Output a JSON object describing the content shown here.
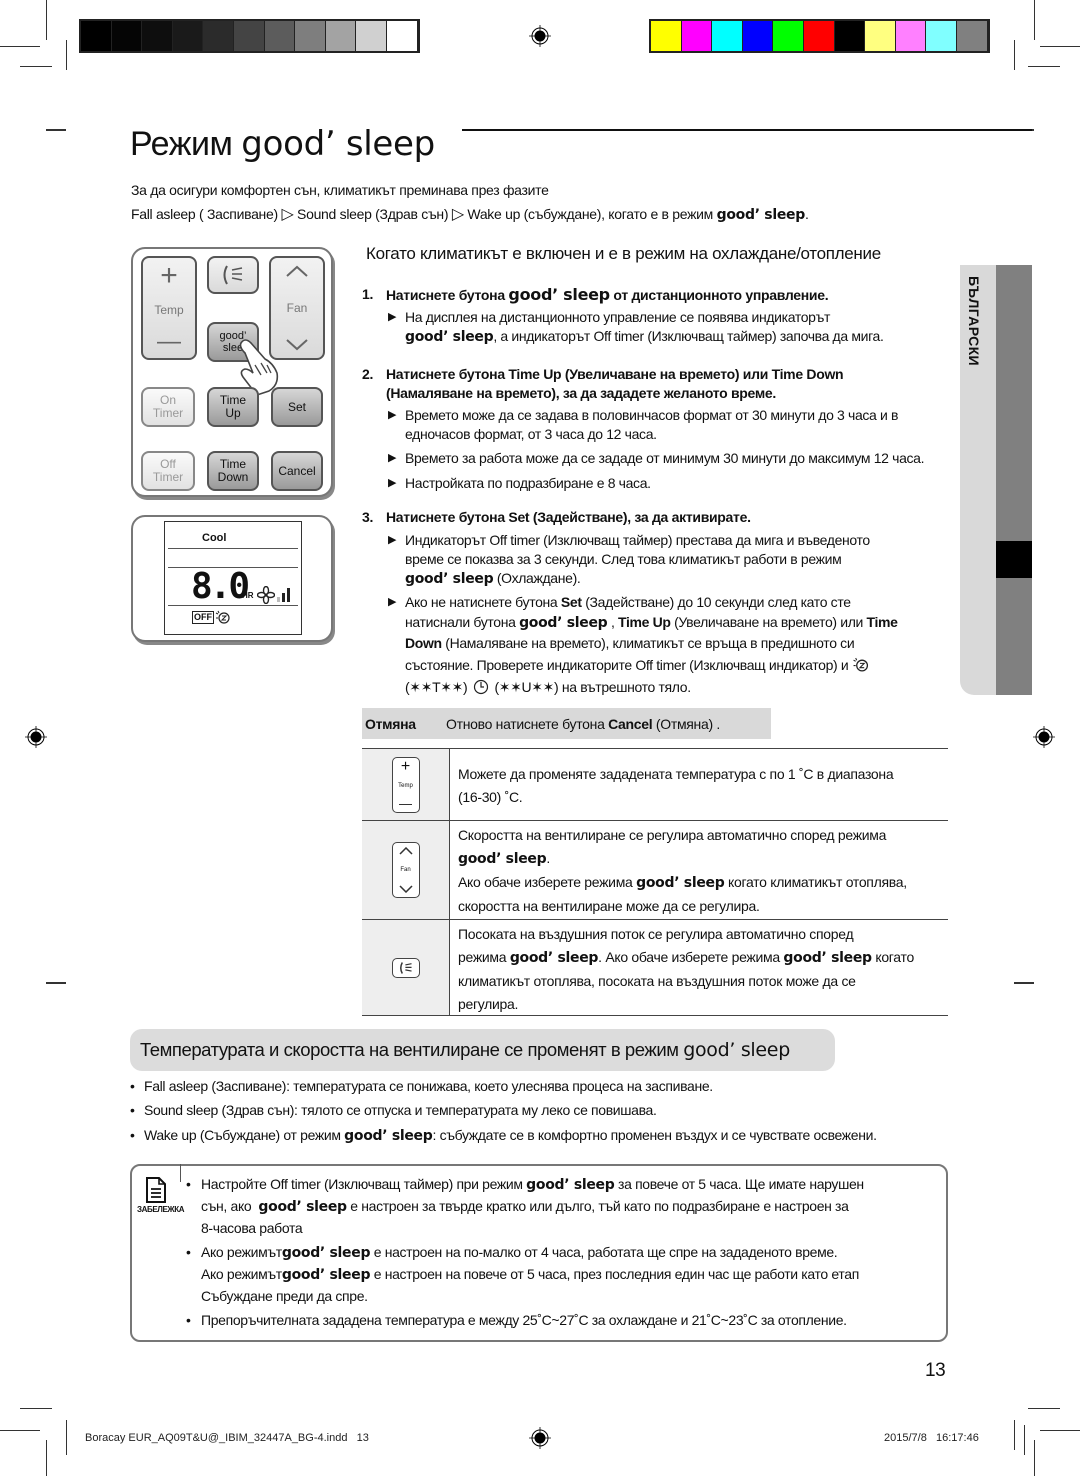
{
  "colors": {
    "grayscale_bar": [
      "#000000",
      "#050505",
      "#0e0e0e",
      "#1a1a1a",
      "#2b2b2b",
      "#444444",
      "#5c5c5c",
      "#7e7e7e",
      "#a3a3a3",
      "#d0d0d0",
      "#ffffff"
    ],
    "color_bar": [
      "#ffff00",
      "#ff00ff",
      "#00ffff",
      "#0000ff",
      "#00ff00",
      "#ff0000",
      "#000000",
      "#ffff80",
      "#ff80ff",
      "#80ffff",
      "#808080"
    ],
    "band_bg": "#dcdcdc",
    "cancel_bg": "#d9d9d9",
    "side_tab_light": "#d9d9d9",
    "side_tab_dark": "#808080"
  },
  "page": {
    "title_prefix": "Режим",
    "title_brand": "good’ sleep",
    "intro_line1": "За да осигури комфортен сън, климатикът преминава през фазите",
    "intro_line2_parts": [
      "Fall asleep ( Заспиване)",
      "Sound sleep (Здрав сън)",
      "Wake up (събуждане), когато е в режим"
    ],
    "intro_brand": "good’ sleep",
    "intro_end": ".",
    "arrow_glyph": "▷"
  },
  "remote": {
    "temp_plus": "+",
    "temp_label": "Temp",
    "temp_minus": "—",
    "fan_up": "︿",
    "fan_label": "Fan",
    "fan_down": "﹀",
    "airflow_icon": "airflow-icon",
    "good_sleep_btn": [
      "good’",
      "slee"
    ],
    "on_timer": [
      "On",
      "Timer"
    ],
    "time_up": [
      "Time",
      "Up"
    ],
    "set": "Set",
    "off_timer": [
      "Off",
      "Timer"
    ],
    "time_down": [
      "Time",
      "Down"
    ],
    "cancel": "Cancel"
  },
  "lcd": {
    "mode": "Cool",
    "time_value": "8.0",
    "time_unit": "HR",
    "off_badge": "OFF",
    "fan_speed_level": "3/3"
  },
  "side_tab": {
    "language": "БЪЛГАРСКИ"
  },
  "section": {
    "heading": "Когато климатикът е включен и е в режим на охлаждане/отопление",
    "steps": [
      {
        "num": "1.",
        "text_before": "Натиснете бутона",
        "brand": "good’ sleep",
        "text_after": "от дистанционното управление.",
        "bullets": [
          {
            "line1": "На дисплея на дистанционното управление се появява индикаторът",
            "brand": "good’ sleep",
            "line2": ", а индикаторът Off timer (Изключващ таймер) започва да мига."
          }
        ]
      },
      {
        "num": "2.",
        "line1": "Натиснете бутона Time Up (Увеличаване на времето) или Time Down",
        "line2": "(Намаляване на времето), за да зададете желаното време.",
        "bullets": [
          {
            "line1": "Времето може да се задава в половинчасов формат от 30 минути до 3 часа и в",
            "line2": "едночасов формат, от 3 часа до 12 часа."
          },
          {
            "line1": "Времето за работа може да се зададе от минимум 30 минути до максимум 12 часа."
          },
          {
            "line1": "Настройката по подразбиране е 8 часа."
          }
        ]
      },
      {
        "num": "3.",
        "line1": "Натиснете бутона Set (Задействане), за да активирате.",
        "bullets": [
          {
            "line1": "Индикаторът Off timer (Изключващ таймер) престава да мига и въведеното",
            "line2": "време се показва за 3 секунди. След това климатикът работи в режим",
            "brand": "good’ sleep",
            "line3": "(Охлаждане)."
          },
          {
            "a1": "Ако не натиснете бутона",
            "a2": "Set",
            "a3": "(Задействане) до 10 секунди след като сте",
            "b1": "натиснали бутона",
            "b2": "good’ sleep",
            "b3": ",",
            "b4": "Time Up",
            "b5": "(Увеличаване на времето) или",
            "b6": "Time",
            "c1": "Down",
            "c2": "(Намаляване на времето), климатикът се връща в предишното си",
            "d1": "състояние. Проверете индикаторите Off timer (Изключващ индикатор) и",
            "e1": "(✶✶T✶✶)",
            "e2": "(✶✶U✶✶) на вътрешното тяло."
          }
        ]
      }
    ],
    "bullet_glyph": "▶"
  },
  "cancel_row": {
    "label": "Отмяна",
    "text_before": "Отново натиснете бутона",
    "button": "Cancel",
    "text_after": "(Отмяна) ."
  },
  "table": {
    "rows": [
      {
        "icon": "temp-button-icon",
        "icon_labels": [
          "+",
          "Temp",
          "—"
        ],
        "line1": "Можете да променяте зададената температура с по 1 ˚C в диапазона",
        "line2": "(16-30) ˚C."
      },
      {
        "icon": "fan-button-icon",
        "icon_labels": [
          "︿",
          "Fan",
          "﹀"
        ],
        "line1": "Скоростта на вентилиране се регулира автоматично според режима",
        "brand": "good’ sleep",
        "line2_end": ".",
        "line3_a": "Ако обаче изберете режима",
        "line3_b": "когато климатикът отоплява,",
        "line4": "скоростта на вентилиране може да се регулира."
      },
      {
        "icon": "airflow-button-icon",
        "line1": "Посоката на въздушния поток се регулира автоматично според",
        "line2_a": "режима",
        "brand": "good’ sleep",
        "line2_b": ". Ако обаче изберете режима",
        "line2_c": "когато",
        "line3": "климатикът отоплява, посоката на въздушния поток може да се",
        "line4": "регулира."
      }
    ]
  },
  "band": {
    "text": "Температурата и скоростта на вентилиране се променят в режим",
    "brand": "good’ sleep"
  },
  "phases": [
    {
      "text": "Fall asleep (Заспиване): температурата се понижава, което улеснява процеса на заспиване."
    },
    {
      "text": "Sound sleep (Здрав сън): тялото се отпуска и температурата му леко се повишава."
    },
    {
      "before": "Wake up (Събуждане) от режим",
      "brand": "good’ sleep",
      "after": ": събуждате се в комфортно променен въздух и се чувствате освежени."
    }
  ],
  "note": {
    "icon_label": "ЗАБЕЛЕЖКА",
    "items": [
      {
        "a": "Настройте Off timer (Изключващ таймер) при режим",
        "brand": "good’ sleep",
        "b": "за повече от 5 часа. Ще имате нарушен",
        "c": "сън, ако",
        "d": "е настроен за твърде кратко или дълго, тъй като по подразбиране е настроен за",
        "e": "8-часова работа"
      },
      {
        "a": "Ако режимът",
        "brand": "good’ sleep",
        "b": "е настроен на по-малко от 4 часа, работата ще спре на зададеното време.",
        "c": "Ако режимът",
        "d": "е настроен на повече от 5 часа, през последния един час ще работи като етап",
        "e": "Събуждане преди да спре."
      },
      {
        "a": "Препоръчителната зададена температура е между 25˚C~27˚C за охлаждане и 21˚C~23˚C за отопление."
      }
    ],
    "bullet": "•"
  },
  "footer": {
    "page_number": "13",
    "file": "Boracay EUR_AQ09T&U@_IBIM_32447A_BG-4.indd   13",
    "date": "2015/7/8   16:17:46"
  }
}
